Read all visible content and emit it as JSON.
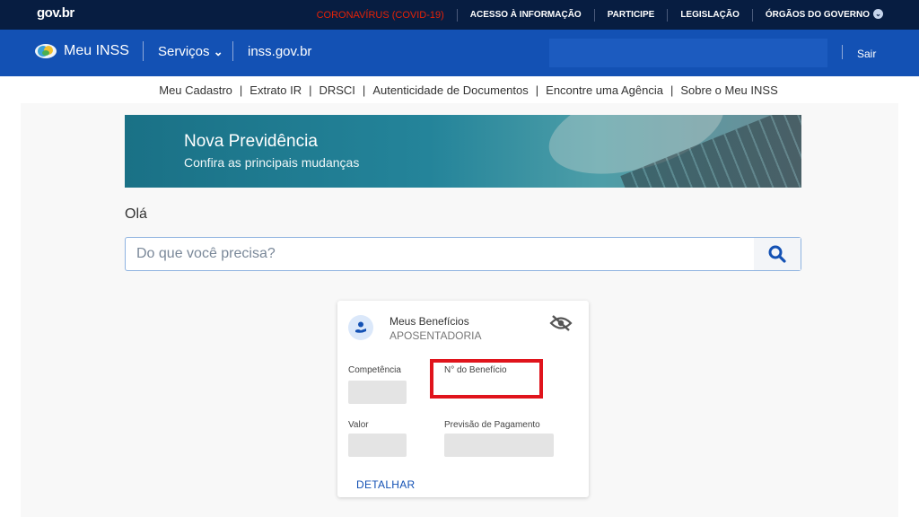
{
  "govbar": {
    "logo": "gov.br",
    "links": [
      "CORONAVÍRUS (COVID-19)",
      "ACESSO À INFORMAÇÃO",
      "PARTICIPE",
      "LEGISLAÇÃO",
      "ÓRGÃOS DO GOVERNO"
    ],
    "chevron": "⌄"
  },
  "navbar": {
    "brand": "Meu INSS",
    "servicos": "Serviços",
    "servicos_chevron": "⌄",
    "site": "inss.gov.br",
    "sair": "Sair"
  },
  "sublinks": [
    "Meu Cadastro",
    "Extrato IR",
    "DRSCI",
    "Autenticidade de Documentos",
    "Encontre uma Agência",
    "Sobre o Meu INSS"
  ],
  "banner": {
    "title": "Nova Previdência",
    "subtitle": "Confira as principais mudanças"
  },
  "greeting": "Olá",
  "search": {
    "placeholder": "Do que você precisa?"
  },
  "card": {
    "title": "Meus Benefícios",
    "subtitle": "APOSENTADORIA",
    "competencia_label": "Competência",
    "beneficio_label": "N° do Benefício",
    "valor_label": "Valor",
    "previsao_label": "Previsão de Pagamento",
    "detalhar": "DETALHAR"
  },
  "colors": {
    "govbar": "#071d41",
    "navbar": "#1351b4",
    "highlight": "#e0141c",
    "covid": "#e52207"
  }
}
